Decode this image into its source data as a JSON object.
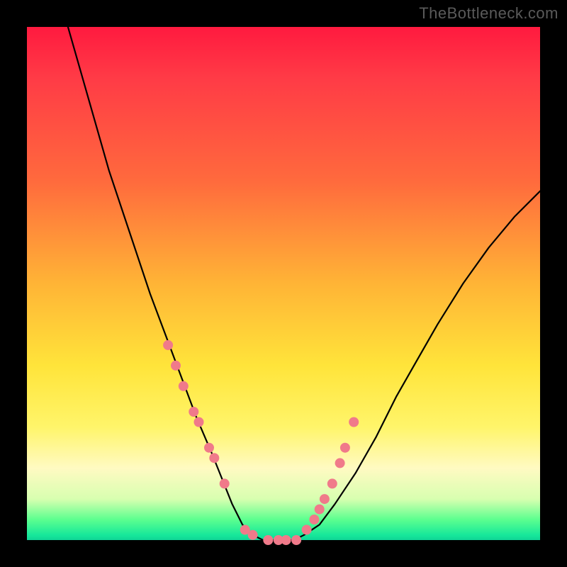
{
  "watermark": "TheBottleneck.com",
  "chart_data": {
    "type": "line",
    "title": "",
    "xlabel": "",
    "ylabel": "",
    "xlim": [
      0,
      100
    ],
    "ylim": [
      0,
      100
    ],
    "grid": false,
    "legend": false,
    "background_gradient": [
      "#ff1a3f",
      "#ffe43a",
      "#17e89a"
    ],
    "series": [
      {
        "name": "bottleneck-curve",
        "color": "#000000",
        "x": [
          8,
          12,
          16,
          20,
          24,
          27,
          30,
          33,
          36,
          38,
          40,
          42,
          44,
          46,
          48,
          50,
          52,
          54,
          57,
          60,
          64,
          68,
          72,
          76,
          80,
          85,
          90,
          95,
          100
        ],
        "y": [
          100,
          86,
          72,
          60,
          48,
          40,
          32,
          24,
          17,
          12,
          7,
          3,
          1,
          0,
          0,
          0,
          0,
          1,
          3,
          7,
          13,
          20,
          28,
          35,
          42,
          50,
          57,
          63,
          68
        ]
      }
    ],
    "markers": {
      "name": "highlight-points",
      "color": "#f07a8a",
      "radius_px": 7,
      "x": [
        27.5,
        29,
        30.5,
        32.5,
        33.5,
        35.5,
        36.5,
        38.5,
        42.5,
        44,
        47,
        49,
        50.5,
        52.5,
        54.5,
        56,
        57,
        58,
        59.5,
        61,
        62,
        63.7
      ],
      "y": [
        38,
        34,
        30,
        25,
        23,
        18,
        16,
        11,
        2,
        1,
        0,
        0,
        0,
        0,
        2,
        4,
        6,
        8,
        11,
        15,
        18,
        23
      ]
    }
  }
}
